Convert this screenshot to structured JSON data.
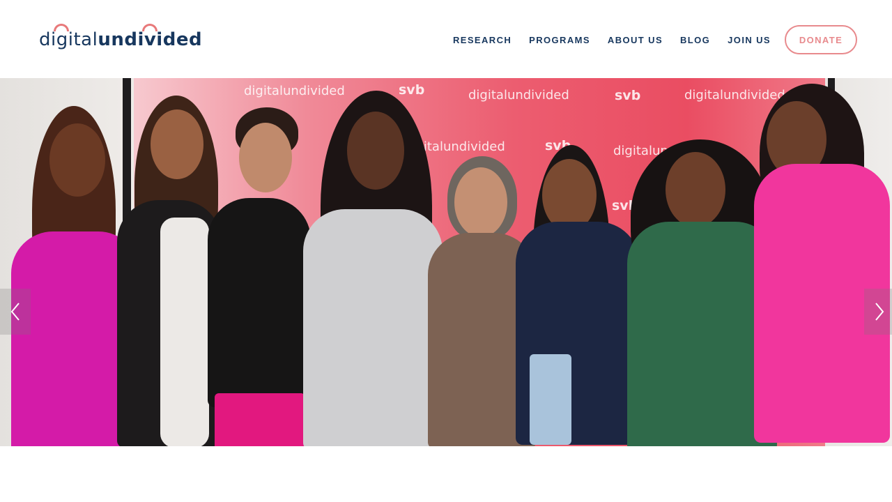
{
  "logo": {
    "part1": "digital",
    "part2": "undivided",
    "text_color": "#17375e",
    "accent_color": "#e8797a"
  },
  "nav": {
    "items": [
      "RESEARCH",
      "PROGRAMS",
      "ABOUT US",
      "BLOG",
      "JOIN US"
    ],
    "donate": "DONATE",
    "donate_color": "#e88a8d"
  },
  "hero": {
    "backdrop_brands": [
      "digitalundivided",
      "svb"
    ],
    "slide_controls": {
      "prev_icon": "chevron-left-icon",
      "next_icon": "chevron-right-icon"
    }
  }
}
